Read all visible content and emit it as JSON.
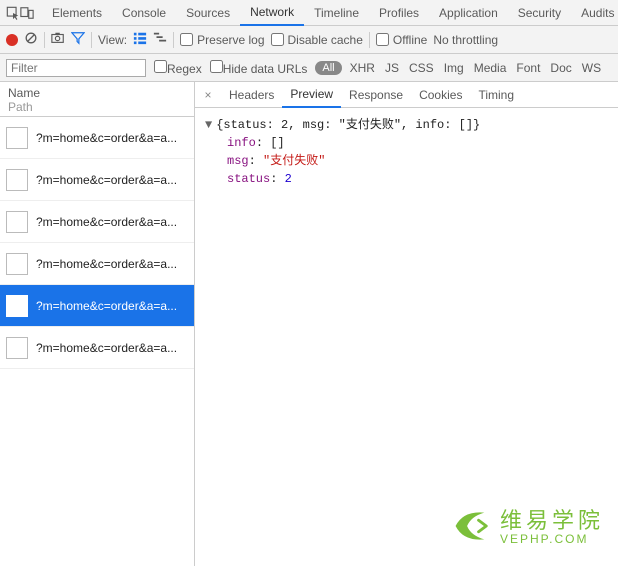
{
  "topTabs": [
    "Elements",
    "Console",
    "Sources",
    "Network",
    "Timeline",
    "Profiles",
    "Application",
    "Security",
    "Audits"
  ],
  "topActiveIndex": 3,
  "toolbar": {
    "viewLabel": "View:",
    "preserveLog": "Preserve log",
    "disableCache": "Disable cache",
    "offline": "Offline",
    "throttling": "No throttling"
  },
  "filter": {
    "placeholder": "Filter",
    "regex": "Regex",
    "hideDataUrls": "Hide data URLs",
    "all": "All",
    "types": [
      "XHR",
      "JS",
      "CSS",
      "Img",
      "Media",
      "Font",
      "Doc",
      "WS"
    ]
  },
  "listHeader": {
    "name": "Name",
    "path": "Path"
  },
  "requests": [
    "?m=home&c=order&a=a...",
    "?m=home&c=order&a=a...",
    "?m=home&c=order&a=a...",
    "?m=home&c=order&a=a...",
    "?m=home&c=order&a=a...",
    "?m=home&c=order&a=a..."
  ],
  "selectedIndex": 4,
  "detailTabs": [
    "Headers",
    "Preview",
    "Response",
    "Cookies",
    "Timing"
  ],
  "detailActiveIndex": 1,
  "previewSummary": "{status: 2, msg: \"支付失败\", info: []}",
  "previewBody": {
    "infoKey": "info",
    "infoVal": "[]",
    "msgKey": "msg",
    "msgVal": "\"支付失败\"",
    "statusKey": "status",
    "statusVal": "2"
  },
  "watermark": {
    "cn": "维易学院",
    "en": "VEPHP.COM"
  }
}
